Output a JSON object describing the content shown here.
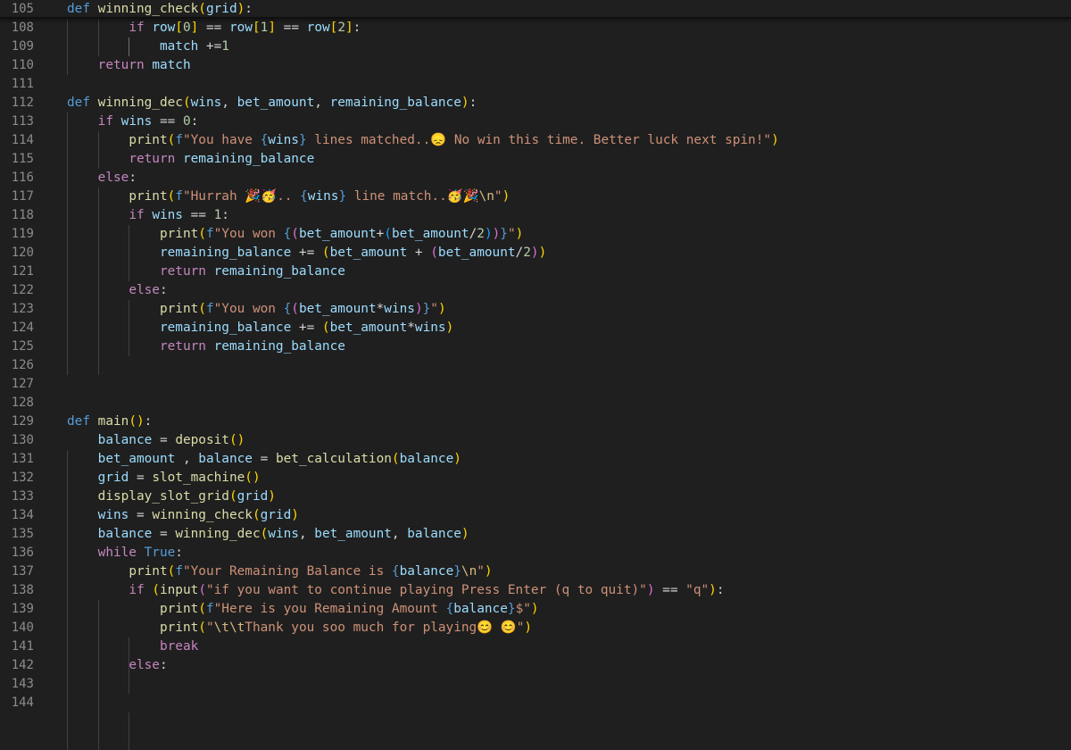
{
  "editor": {
    "lines": [
      {
        "n": "105",
        "tokens": [
          {
            "t": "def ",
            "c": "kw"
          },
          {
            "t": "winning_check",
            "c": "fn"
          },
          {
            "t": "(",
            "c": "b1"
          },
          {
            "t": "grid",
            "c": "vr"
          },
          {
            "t": ")",
            "c": "b1"
          },
          {
            "t": ":",
            "c": "op"
          }
        ]
      },
      {
        "n": "108",
        "tokens": [
          {
            "t": "        ",
            "c": "op"
          },
          {
            "t": "if ",
            "c": "ctl"
          },
          {
            "t": "row",
            "c": "vr"
          },
          {
            "t": "[",
            "c": "b1"
          },
          {
            "t": "0",
            "c": "nu"
          },
          {
            "t": "]",
            "c": "b1"
          },
          {
            "t": " == ",
            "c": "op"
          },
          {
            "t": "row",
            "c": "vr"
          },
          {
            "t": "[",
            "c": "b1"
          },
          {
            "t": "1",
            "c": "nu"
          },
          {
            "t": "]",
            "c": "b1"
          },
          {
            "t": " == ",
            "c": "op"
          },
          {
            "t": "row",
            "c": "vr"
          },
          {
            "t": "[",
            "c": "b1"
          },
          {
            "t": "2",
            "c": "nu"
          },
          {
            "t": "]",
            "c": "b1"
          },
          {
            "t": ":",
            "c": "op"
          }
        ]
      },
      {
        "n": "109",
        "tokens": [
          {
            "t": "            ",
            "c": "op"
          },
          {
            "t": "match",
            "c": "vr"
          },
          {
            "t": " +=",
            "c": "op"
          },
          {
            "t": "1",
            "c": "nu"
          }
        ]
      },
      {
        "n": "110",
        "tokens": [
          {
            "t": "    ",
            "c": "op"
          },
          {
            "t": "return ",
            "c": "ctl"
          },
          {
            "t": "match",
            "c": "vr"
          }
        ]
      },
      {
        "n": "111",
        "tokens": []
      },
      {
        "n": "112",
        "tokens": [
          {
            "t": "def ",
            "c": "kw"
          },
          {
            "t": "winning_dec",
            "c": "fn"
          },
          {
            "t": "(",
            "c": "b1"
          },
          {
            "t": "wins",
            "c": "vr"
          },
          {
            "t": ", ",
            "c": "op"
          },
          {
            "t": "bet_amount",
            "c": "vr"
          },
          {
            "t": ", ",
            "c": "op"
          },
          {
            "t": "remaining_balance",
            "c": "vr"
          },
          {
            "t": ")",
            "c": "b1"
          },
          {
            "t": ":",
            "c": "op"
          }
        ]
      },
      {
        "n": "113",
        "tokens": [
          {
            "t": "    ",
            "c": "op"
          },
          {
            "t": "if ",
            "c": "ctl"
          },
          {
            "t": "wins",
            "c": "vr"
          },
          {
            "t": " == ",
            "c": "op"
          },
          {
            "t": "0",
            "c": "nu"
          },
          {
            "t": ":",
            "c": "op"
          }
        ]
      },
      {
        "n": "114",
        "tokens": [
          {
            "t": "        ",
            "c": "op"
          },
          {
            "t": "print",
            "c": "fn"
          },
          {
            "t": "(",
            "c": "b1"
          },
          {
            "t": "f",
            "c": "kw"
          },
          {
            "t": "\"You have ",
            "c": "st"
          },
          {
            "t": "{",
            "c": "kw"
          },
          {
            "t": "wins",
            "c": "vr"
          },
          {
            "t": "}",
            "c": "kw"
          },
          {
            "t": " lines matched..😞 No win this time. Better luck next spin!\"",
            "c": "st"
          },
          {
            "t": ")",
            "c": "b1"
          }
        ]
      },
      {
        "n": "115",
        "tokens": [
          {
            "t": "        ",
            "c": "op"
          },
          {
            "t": "return ",
            "c": "ctl"
          },
          {
            "t": "remaining_balance",
            "c": "vr"
          }
        ]
      },
      {
        "n": "116",
        "tokens": [
          {
            "t": "    ",
            "c": "op"
          },
          {
            "t": "else",
            "c": "ctl"
          },
          {
            "t": ":",
            "c": "op"
          }
        ]
      },
      {
        "n": "117",
        "tokens": [
          {
            "t": "        ",
            "c": "op"
          },
          {
            "t": "print",
            "c": "fn"
          },
          {
            "t": "(",
            "c": "b1"
          },
          {
            "t": "f",
            "c": "kw"
          },
          {
            "t": "\"Hurrah 🎉🥳.. ",
            "c": "st"
          },
          {
            "t": "{",
            "c": "kw"
          },
          {
            "t": "wins",
            "c": "vr"
          },
          {
            "t": "}",
            "c": "kw"
          },
          {
            "t": " line match..🥳🎉",
            "c": "st"
          },
          {
            "t": "\\n",
            "c": "es"
          },
          {
            "t": "\"",
            "c": "st"
          },
          {
            "t": ")",
            "c": "b1"
          }
        ]
      },
      {
        "n": "118",
        "tokens": [
          {
            "t": "        ",
            "c": "op"
          },
          {
            "t": "if ",
            "c": "ctl"
          },
          {
            "t": "wins",
            "c": "vr"
          },
          {
            "t": " == ",
            "c": "op"
          },
          {
            "t": "1",
            "c": "nu"
          },
          {
            "t": ":",
            "c": "op"
          }
        ]
      },
      {
        "n": "119",
        "tokens": [
          {
            "t": "            ",
            "c": "op"
          },
          {
            "t": "print",
            "c": "fn"
          },
          {
            "t": "(",
            "c": "b1"
          },
          {
            "t": "f",
            "c": "kw"
          },
          {
            "t": "\"You won ",
            "c": "st"
          },
          {
            "t": "{",
            "c": "kw"
          },
          {
            "t": "(",
            "c": "b2"
          },
          {
            "t": "bet_amount",
            "c": "vr"
          },
          {
            "t": "+",
            "c": "op"
          },
          {
            "t": "(",
            "c": "b3"
          },
          {
            "t": "bet_amount",
            "c": "vr"
          },
          {
            "t": "/",
            "c": "op"
          },
          {
            "t": "2",
            "c": "nu"
          },
          {
            "t": ")",
            "c": "b3"
          },
          {
            "t": ")",
            "c": "b2"
          },
          {
            "t": "}",
            "c": "kw"
          },
          {
            "t": "\"",
            "c": "st"
          },
          {
            "t": ")",
            "c": "b1"
          }
        ]
      },
      {
        "n": "120",
        "tokens": [
          {
            "t": "            ",
            "c": "op"
          },
          {
            "t": "remaining_balance",
            "c": "vr"
          },
          {
            "t": " += ",
            "c": "op"
          },
          {
            "t": "(",
            "c": "b1"
          },
          {
            "t": "bet_amount",
            "c": "vr"
          },
          {
            "t": " + ",
            "c": "op"
          },
          {
            "t": "(",
            "c": "b2"
          },
          {
            "t": "bet_amount",
            "c": "vr"
          },
          {
            "t": "/",
            "c": "op"
          },
          {
            "t": "2",
            "c": "nu"
          },
          {
            "t": ")",
            "c": "b2"
          },
          {
            "t": ")",
            "c": "b1"
          }
        ]
      },
      {
        "n": "121",
        "tokens": [
          {
            "t": "            ",
            "c": "op"
          },
          {
            "t": "return ",
            "c": "ctl"
          },
          {
            "t": "remaining_balance",
            "c": "vr"
          }
        ]
      },
      {
        "n": "122",
        "tokens": [
          {
            "t": "        ",
            "c": "op"
          },
          {
            "t": "else",
            "c": "ctl"
          },
          {
            "t": ":",
            "c": "op"
          }
        ]
      },
      {
        "n": "123",
        "tokens": [
          {
            "t": "            ",
            "c": "op"
          },
          {
            "t": "print",
            "c": "fn"
          },
          {
            "t": "(",
            "c": "b1"
          },
          {
            "t": "f",
            "c": "kw"
          },
          {
            "t": "\"You won ",
            "c": "st"
          },
          {
            "t": "{",
            "c": "kw"
          },
          {
            "t": "(",
            "c": "b2"
          },
          {
            "t": "bet_amount",
            "c": "vr"
          },
          {
            "t": "*",
            "c": "op"
          },
          {
            "t": "wins",
            "c": "vr"
          },
          {
            "t": ")",
            "c": "b2"
          },
          {
            "t": "}",
            "c": "kw"
          },
          {
            "t": "\"",
            "c": "st"
          },
          {
            "t": ")",
            "c": "b1"
          }
        ]
      },
      {
        "n": "124",
        "tokens": [
          {
            "t": "            ",
            "c": "op"
          },
          {
            "t": "remaining_balance",
            "c": "vr"
          },
          {
            "t": " += ",
            "c": "op"
          },
          {
            "t": "(",
            "c": "b1"
          },
          {
            "t": "bet_amount",
            "c": "vr"
          },
          {
            "t": "*",
            "c": "op"
          },
          {
            "t": "wins",
            "c": "vr"
          },
          {
            "t": ")",
            "c": "b1"
          }
        ]
      },
      {
        "n": "125",
        "tokens": [
          {
            "t": "            ",
            "c": "op"
          },
          {
            "t": "return ",
            "c": "ctl"
          },
          {
            "t": "remaining_balance",
            "c": "vr"
          }
        ]
      },
      {
        "n": "126",
        "tokens": []
      },
      {
        "n": "127",
        "tokens": []
      },
      {
        "n": "128",
        "tokens": []
      },
      {
        "n": "129",
        "tokens": [
          {
            "t": "def ",
            "c": "kw"
          },
          {
            "t": "main",
            "c": "fn"
          },
          {
            "t": "(",
            "c": "b1"
          },
          {
            "t": ")",
            "c": "b1"
          },
          {
            "t": ":",
            "c": "op"
          }
        ]
      },
      {
        "n": "130",
        "tokens": [
          {
            "t": "    ",
            "c": "op"
          },
          {
            "t": "balance",
            "c": "vr"
          },
          {
            "t": " = ",
            "c": "op"
          },
          {
            "t": "deposit",
            "c": "fn"
          },
          {
            "t": "(",
            "c": "b1"
          },
          {
            "t": ")",
            "c": "b1"
          }
        ]
      },
      {
        "n": "131",
        "tokens": [
          {
            "t": "    ",
            "c": "op"
          },
          {
            "t": "bet_amount",
            "c": "vr"
          },
          {
            "t": " , ",
            "c": "op"
          },
          {
            "t": "balance",
            "c": "vr"
          },
          {
            "t": " = ",
            "c": "op"
          },
          {
            "t": "bet_calculation",
            "c": "fn"
          },
          {
            "t": "(",
            "c": "b1"
          },
          {
            "t": "balance",
            "c": "vr"
          },
          {
            "t": ")",
            "c": "b1"
          }
        ]
      },
      {
        "n": "132",
        "tokens": [
          {
            "t": "    ",
            "c": "op"
          },
          {
            "t": "grid",
            "c": "vr"
          },
          {
            "t": " = ",
            "c": "op"
          },
          {
            "t": "slot_machine",
            "c": "fn"
          },
          {
            "t": "(",
            "c": "b1"
          },
          {
            "t": ")",
            "c": "b1"
          }
        ]
      },
      {
        "n": "133",
        "tokens": [
          {
            "t": "    ",
            "c": "op"
          },
          {
            "t": "display_slot_grid",
            "c": "fn"
          },
          {
            "t": "(",
            "c": "b1"
          },
          {
            "t": "grid",
            "c": "vr"
          },
          {
            "t": ")",
            "c": "b1"
          }
        ]
      },
      {
        "n": "134",
        "tokens": [
          {
            "t": "    ",
            "c": "op"
          },
          {
            "t": "wins",
            "c": "vr"
          },
          {
            "t": " = ",
            "c": "op"
          },
          {
            "t": "winning_check",
            "c": "fn"
          },
          {
            "t": "(",
            "c": "b1"
          },
          {
            "t": "grid",
            "c": "vr"
          },
          {
            "t": ")",
            "c": "b1"
          }
        ]
      },
      {
        "n": "135",
        "tokens": [
          {
            "t": "    ",
            "c": "op"
          },
          {
            "t": "balance",
            "c": "vr"
          },
          {
            "t": " = ",
            "c": "op"
          },
          {
            "t": "winning_dec",
            "c": "fn"
          },
          {
            "t": "(",
            "c": "b1"
          },
          {
            "t": "wins",
            "c": "vr"
          },
          {
            "t": ", ",
            "c": "op"
          },
          {
            "t": "bet_amount",
            "c": "vr"
          },
          {
            "t": ", ",
            "c": "op"
          },
          {
            "t": "balance",
            "c": "vr"
          },
          {
            "t": ")",
            "c": "b1"
          }
        ]
      },
      {
        "n": "136",
        "tokens": [
          {
            "t": "    ",
            "c": "op"
          },
          {
            "t": "while ",
            "c": "ctl"
          },
          {
            "t": "True",
            "c": "kw"
          },
          {
            "t": ":",
            "c": "op"
          }
        ]
      },
      {
        "n": "137",
        "tokens": [
          {
            "t": "        ",
            "c": "op"
          },
          {
            "t": "print",
            "c": "fn"
          },
          {
            "t": "(",
            "c": "b1"
          },
          {
            "t": "f",
            "c": "kw"
          },
          {
            "t": "\"Your Remaining Balance is ",
            "c": "st"
          },
          {
            "t": "{",
            "c": "kw"
          },
          {
            "t": "balance",
            "c": "vr"
          },
          {
            "t": "}",
            "c": "kw"
          },
          {
            "t": "\\n",
            "c": "es"
          },
          {
            "t": "\"",
            "c": "st"
          },
          {
            "t": ")",
            "c": "b1"
          }
        ]
      },
      {
        "n": "138",
        "tokens": [
          {
            "t": "        ",
            "c": "op"
          },
          {
            "t": "if ",
            "c": "ctl"
          },
          {
            "t": "(",
            "c": "b1"
          },
          {
            "t": "input",
            "c": "fn"
          },
          {
            "t": "(",
            "c": "b2"
          },
          {
            "t": "\"if you want to continue playing Press Enter (q to quit)\"",
            "c": "st"
          },
          {
            "t": ")",
            "c": "b2"
          },
          {
            "t": " == ",
            "c": "op"
          },
          {
            "t": "\"q\"",
            "c": "st"
          },
          {
            "t": ")",
            "c": "b1"
          },
          {
            "t": ":",
            "c": "op"
          }
        ]
      },
      {
        "n": "139",
        "tokens": [
          {
            "t": "            ",
            "c": "op"
          },
          {
            "t": "print",
            "c": "fn"
          },
          {
            "t": "(",
            "c": "b1"
          },
          {
            "t": "f",
            "c": "kw"
          },
          {
            "t": "\"Here is you Remaining Amount ",
            "c": "st"
          },
          {
            "t": "{",
            "c": "kw"
          },
          {
            "t": "balance",
            "c": "vr"
          },
          {
            "t": "}",
            "c": "kw"
          },
          {
            "t": "$\"",
            "c": "st"
          },
          {
            "t": ")",
            "c": "b1"
          }
        ]
      },
      {
        "n": "140",
        "tokens": [
          {
            "t": "            ",
            "c": "op"
          },
          {
            "t": "print",
            "c": "fn"
          },
          {
            "t": "(",
            "c": "b1"
          },
          {
            "t": "\"",
            "c": "st"
          },
          {
            "t": "\\t\\t",
            "c": "es"
          },
          {
            "t": "Thank you soo much for playing😊 😊\"",
            "c": "st"
          },
          {
            "t": ")",
            "c": "b1"
          }
        ]
      },
      {
        "n": "141",
        "tokens": [
          {
            "t": "            ",
            "c": "op"
          },
          {
            "t": "break",
            "c": "ctl"
          }
        ]
      },
      {
        "n": "142",
        "tokens": [
          {
            "t": "        ",
            "c": "op"
          },
          {
            "t": "else",
            "c": "ctl"
          },
          {
            "t": ":",
            "c": "op"
          }
        ]
      },
      {
        "n": "143",
        "tokens": []
      },
      {
        "n": "144",
        "tokens": []
      }
    ]
  }
}
